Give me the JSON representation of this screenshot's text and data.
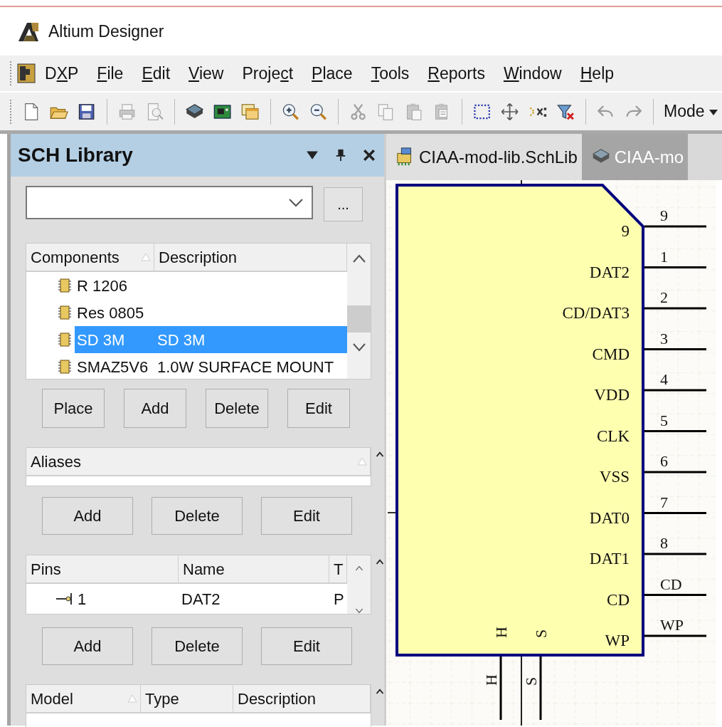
{
  "app": {
    "title": "Altium Designer"
  },
  "menu": [
    {
      "pre": "D",
      "key": "X",
      "post": "P"
    },
    {
      "key": "F",
      "post": "ile"
    },
    {
      "key": "E",
      "post": "dit"
    },
    {
      "key": "V",
      "post": "iew"
    },
    {
      "pre": "Proje",
      "key": "c",
      "post": "t"
    },
    {
      "key": "P",
      "post": "lace"
    },
    {
      "key": "T",
      "post": "ools"
    },
    {
      "key": "R",
      "post": "eports"
    },
    {
      "key": "W",
      "post": "indow"
    },
    {
      "key": "H",
      "post": "elp"
    }
  ],
  "toolbar": {
    "groups": [
      [
        {
          "kind": "new",
          "disabled": false
        },
        {
          "kind": "open",
          "disabled": false
        },
        {
          "kind": "save",
          "disabled": false
        }
      ],
      [
        {
          "kind": "print",
          "disabled": true
        },
        {
          "kind": "preview",
          "disabled": true
        }
      ],
      [
        {
          "kind": "chip",
          "disabled": false
        },
        {
          "kind": "board",
          "disabled": false
        },
        {
          "kind": "windows",
          "disabled": false
        }
      ],
      [
        {
          "kind": "zoom-in",
          "disabled": false
        },
        {
          "kind": "zoom-out",
          "disabled": false
        }
      ],
      [
        {
          "kind": "cut",
          "disabled": true
        },
        {
          "kind": "copy",
          "disabled": true
        },
        {
          "kind": "paste",
          "disabled": true
        },
        {
          "kind": "paste-special",
          "disabled": true
        }
      ],
      [
        {
          "kind": "select-area",
          "disabled": false
        },
        {
          "kind": "move",
          "disabled": false
        },
        {
          "kind": "select-cross",
          "disabled": false
        },
        {
          "kind": "filter-clear",
          "disabled": false
        }
      ],
      [
        {
          "kind": "undo",
          "disabled": true
        },
        {
          "kind": "redo",
          "disabled": true
        }
      ]
    ],
    "mode": "Mode"
  },
  "panel": {
    "title": "SCH Library",
    "browse_button": "...",
    "components": {
      "columns": [
        "Components",
        "Description"
      ],
      "rows": [
        {
          "name": "R 1206",
          "selected": false
        },
        {
          "name": "Res 0805",
          "selected": false
        },
        {
          "name": "SD 3M",
          "description": "SD 3M",
          "selected": true
        },
        {
          "name": "SMAZ5V6",
          "description": "1.0W SURFACE MOUNT",
          "selected": false
        }
      ],
      "buttons": [
        "Place",
        "Add",
        "Delete",
        "Edit"
      ]
    },
    "aliases": {
      "columns": [
        "Aliases"
      ],
      "buttons": [
        "Add",
        "Delete",
        "Edit"
      ]
    },
    "pins": {
      "columns": [
        "Pins",
        "Name",
        "T"
      ],
      "rows": [
        {
          "pin": "1",
          "name": "DAT2",
          "type": "P"
        }
      ],
      "buttons": [
        "Add",
        "Delete",
        "Edit"
      ]
    },
    "models": {
      "columns": [
        "Model",
        "Type",
        "Description"
      ]
    }
  },
  "tabs": [
    {
      "label": "CIAA-mod-lib.SchLib",
      "kind": "schlib",
      "selected": true
    },
    {
      "label": "CIAA-mo",
      "kind": "pcblib",
      "selected": false
    }
  ],
  "schematic": {
    "right_pins": [
      {
        "number": "9",
        "name": "9"
      },
      {
        "number": "1",
        "name": "DAT2"
      },
      {
        "number": "2",
        "name": "CD/DAT3"
      },
      {
        "number": "3",
        "name": "CMD"
      },
      {
        "number": "4",
        "name": "VDD"
      },
      {
        "number": "5",
        "name": "CLK"
      },
      {
        "number": "6",
        "name": "VSS"
      },
      {
        "number": "7",
        "name": "DAT0"
      },
      {
        "number": "8",
        "name": "DAT1"
      },
      {
        "number": "CD",
        "name": "CD"
      },
      {
        "number": "WP",
        "name": "WP"
      }
    ],
    "bottom_pins": [
      {
        "number": "H",
        "name": "H"
      },
      {
        "number": "S",
        "name": "S"
      }
    ]
  }
}
